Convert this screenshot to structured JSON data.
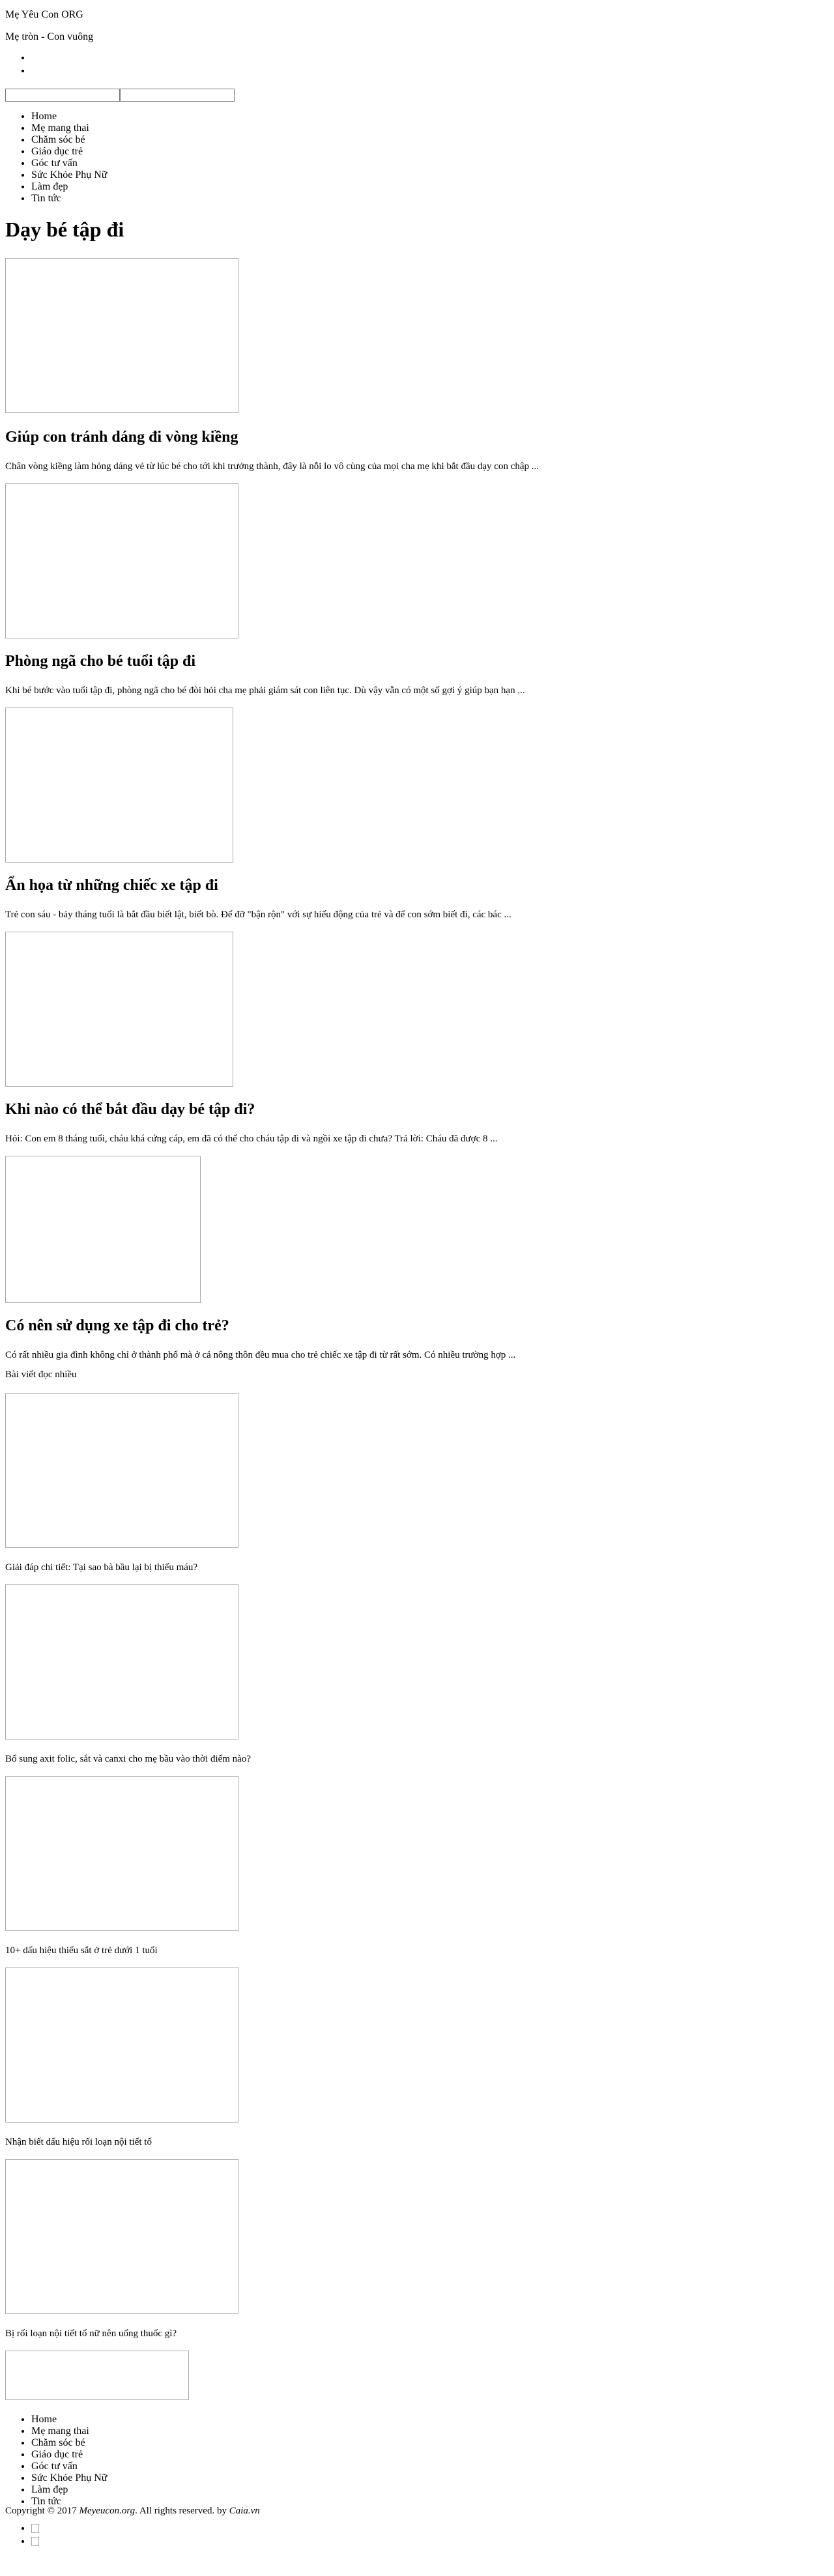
{
  "site": {
    "name": "Mẹ Yêu Con ORG",
    "tagline": "Mẹ tròn - Con vuông"
  },
  "search": {
    "input_value": "",
    "button_value": ""
  },
  "nav": [
    "Home",
    "Mẹ mang thai",
    "Chăm sóc bé",
    "Giáo dục trẻ",
    "Góc tư vấn",
    "Sức Khỏe Phụ Nữ",
    "Làm đẹp",
    "Tin tức"
  ],
  "page": {
    "title": "Dạy bé tập đi"
  },
  "posts": [
    {
      "title": "Giúp con tránh dáng đi vòng kiềng",
      "excerpt": "Chân vòng kiềng làm hỏng dáng vẻ từ lúc bé cho tới khi trưởng thành, đây là nỗi lo vô cùng của mọi cha mẹ khi bắt đầu dạy con chập ..."
    },
    {
      "title": "Phòng ngã cho bé tuổi tập đi",
      "excerpt": "Khi bé bước vào tuổi tập đi, phòng ngã cho bé đòi hỏi cha mẹ phải giám sát con liên tục. Dù vậy vẫn có một số gợi ý giúp bạn hạn ..."
    },
    {
      "title": "Ẩn họa từ những chiếc xe tập đi",
      "excerpt": "Trẻ con sáu - bảy tháng tuổi là bắt đầu biết lật, biết bò. Để đỡ \"bận rộn\" với sự hiếu động của trẻ và để con sớm biết đi, các bác ..."
    },
    {
      "title": "Khi nào có thể bắt đầu dạy bé tập đi?",
      "excerpt": "Hỏi: Con em 8 tháng tuổi, cháu khá cứng cáp, em đã có thể cho cháu tập đi và ngồi xe tập đi chưa? Trả lời: Cháu đã được 8 ..."
    },
    {
      "title": "Có nên sử dụng xe tập đi cho trẻ?",
      "excerpt": "Có rất nhiều gia đình không chỉ ở thành phố mà ở cả nông thôn đều mua cho trẻ chiếc xe tập đi từ rất sớm. Có nhiều trường hợp ..."
    }
  ],
  "popular": {
    "label": "Bài viết đọc nhiều",
    "items": [
      "Giải đáp chi tiết: Tại sao bà bầu lại bị thiếu máu?",
      "Bổ sung axit folic, sắt và canxi cho mẹ bầu vào thời điểm nào?",
      "10+ dấu hiệu thiếu sắt ở trẻ dưới 1 tuổi",
      "Nhận biết dấu hiệu rối loạn nội tiết tố",
      "Bị rối loạn nội tiết tố nữ nên uống thuốc gì?"
    ]
  },
  "footer": {
    "copyright_prefix": "Copyright © 2017 ",
    "copyright_site": "Meyeucon.org",
    "copyright_mid": ". All rights reserved. by ",
    "copyright_author": "Caia.vn"
  }
}
